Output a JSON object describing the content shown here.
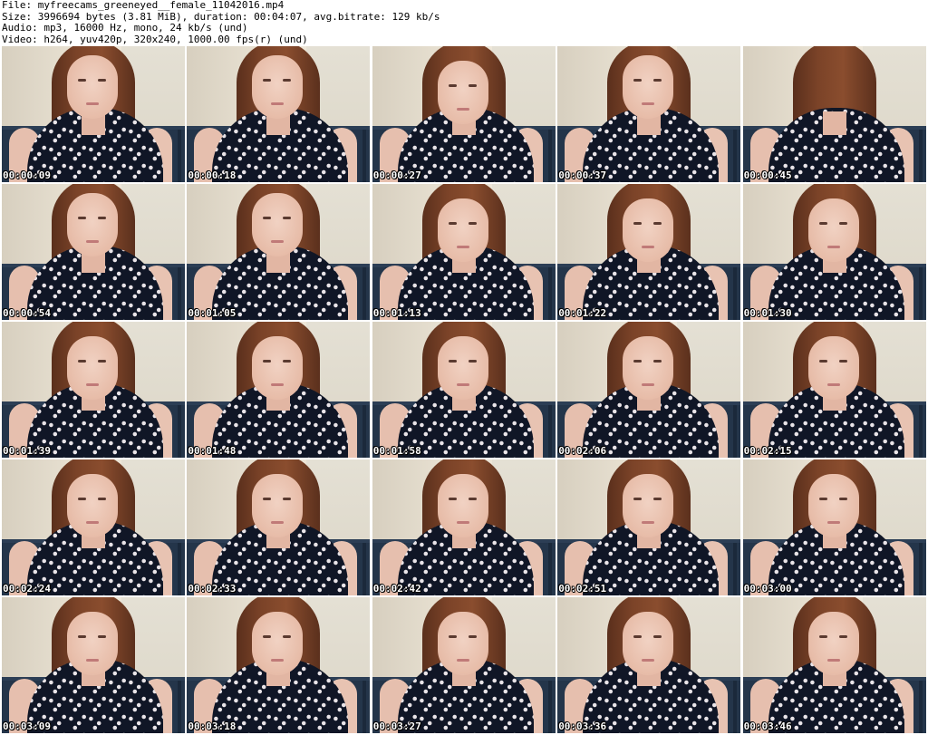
{
  "info": {
    "file_line": "File: myfreecams_greeneyed__female_11042016.mp4",
    "size_line": "Size: 3996694 bytes (3.81 MiB), duration: 00:04:07, avg.bitrate: 129 kb/s",
    "audio_line": "Audio: mp3, 16000 Hz, mono, 24 kb/s (und)",
    "video_line": "Video: h264, yuv420p, 320x240, 1000.00 fps(r) (und)"
  },
  "frames": [
    {
      "timestamp": "00:00:09",
      "pose": "front"
    },
    {
      "timestamp": "00:00:18",
      "pose": "front"
    },
    {
      "timestamp": "00:00:27",
      "pose": "down"
    },
    {
      "timestamp": "00:00:37",
      "pose": "front"
    },
    {
      "timestamp": "00:00:45",
      "pose": "away"
    },
    {
      "timestamp": "00:00:54",
      "pose": "front"
    },
    {
      "timestamp": "00:01:05",
      "pose": "front"
    },
    {
      "timestamp": "00:01:13",
      "pose": "down"
    },
    {
      "timestamp": "00:01:22",
      "pose": "down"
    },
    {
      "timestamp": "00:01:30",
      "pose": "down"
    },
    {
      "timestamp": "00:01:39",
      "pose": "down"
    },
    {
      "timestamp": "00:01:48",
      "pose": "down"
    },
    {
      "timestamp": "00:01:58",
      "pose": "down"
    },
    {
      "timestamp": "00:02:06",
      "pose": "down"
    },
    {
      "timestamp": "00:02:15",
      "pose": "down"
    },
    {
      "timestamp": "00:02:24",
      "pose": "down"
    },
    {
      "timestamp": "00:02:33",
      "pose": "down"
    },
    {
      "timestamp": "00:02:42",
      "pose": "down"
    },
    {
      "timestamp": "00:02:51",
      "pose": "down"
    },
    {
      "timestamp": "00:03:00",
      "pose": "down"
    },
    {
      "timestamp": "00:03:09",
      "pose": "down"
    },
    {
      "timestamp": "00:03:18",
      "pose": "down"
    },
    {
      "timestamp": "00:03:27",
      "pose": "down"
    },
    {
      "timestamp": "00:03:36",
      "pose": "down"
    },
    {
      "timestamp": "00:03:46",
      "pose": "down"
    }
  ]
}
